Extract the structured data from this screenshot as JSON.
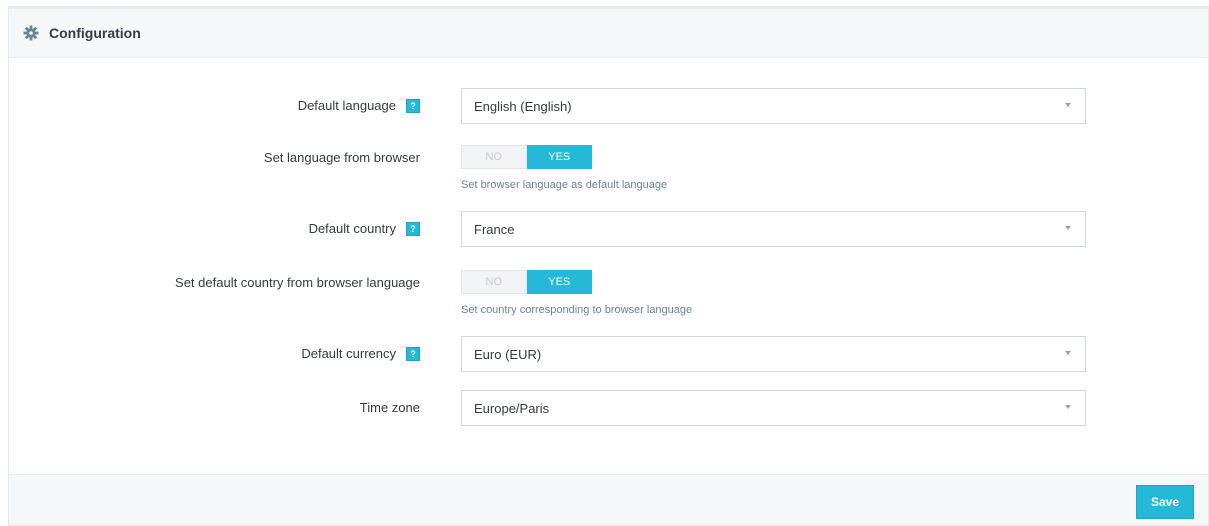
{
  "panel": {
    "title": "Configuration",
    "icon": "gear-icon"
  },
  "fields": {
    "default_language": {
      "label": "Default language",
      "value": "English (English)",
      "help": "?"
    },
    "language_from_browser": {
      "label": "Set language from browser",
      "no": "NO",
      "yes": "YES",
      "selected": "YES",
      "hint": "Set browser language as default language"
    },
    "default_country": {
      "label": "Default country",
      "value": "France",
      "help": "?"
    },
    "country_from_browser": {
      "label": "Set default country from browser language",
      "no": "NO",
      "yes": "YES",
      "selected": "YES",
      "hint": "Set country corresponding to browser language"
    },
    "default_currency": {
      "label": "Default currency",
      "value": "Euro (EUR)",
      "help": "?"
    },
    "time_zone": {
      "label": "Time zone",
      "value": "Europe/Paris"
    }
  },
  "footer": {
    "save_label": "Save"
  },
  "colors": {
    "accent": "#25b9d7",
    "heading_bg": "#f5f8f9",
    "text": "#363a41",
    "hint": "#6c868e"
  }
}
